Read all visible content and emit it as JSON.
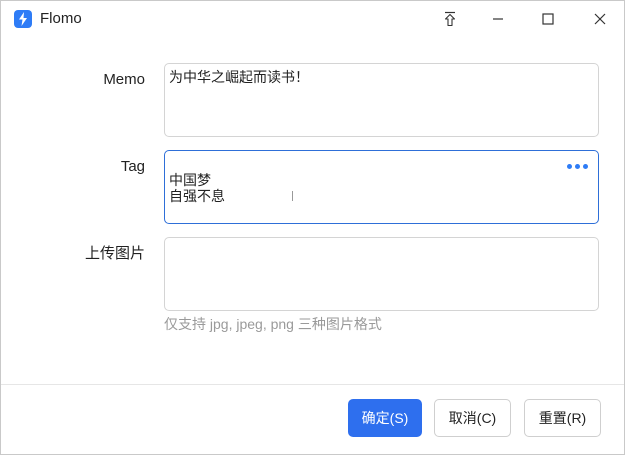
{
  "window": {
    "title": "Flomo",
    "accent_color": "#2e7cf6"
  },
  "form": {
    "memo": {
      "label": "Memo",
      "value": "为中华之崛起而读书！"
    },
    "tag": {
      "label": "Tag",
      "value": "中国梦\n自强不息",
      "more_icon": "more-horizontal-icon"
    },
    "upload": {
      "label": "上传图片",
      "value": "",
      "hint": "仅支持 jpg, jpeg, png 三种图片格式"
    }
  },
  "buttons": {
    "confirm": "确定(S)",
    "cancel": "取消(C)",
    "reset": "重置(R)"
  }
}
